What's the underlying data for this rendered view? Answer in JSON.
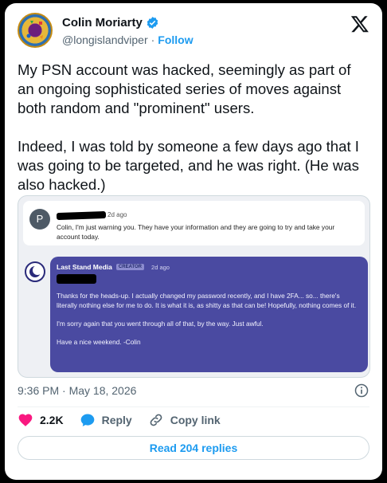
{
  "author": {
    "name": "Colin Moriarty",
    "handle": "@longislandviper",
    "separator": "·",
    "follow_label": "Follow"
  },
  "tweet": {
    "text": "My PSN account was hacked, seemingly as part of an ongoing sophisticated series of moves against both random and \"prominent\" users.\n\nIndeed, I was told by someone a few days ago that I was going to be targeted, and he was right. (He was also hacked.)"
  },
  "media": {
    "message1": {
      "avatar_letter": "P",
      "time": "2d ago",
      "text": "Colin, I'm just warning you. They have your information and they are going to try and take your account today."
    },
    "message2": {
      "author": "Last Stand Media",
      "badge": "CREATOR",
      "time": "2d ago",
      "paragraphs": [
        "Thanks for the heads-up. I actually changed my password recently, and I have 2FA... so... there's literally nothing else for me to do. It is what it is, as shitty as that can be! Hopefully, nothing comes of it.",
        "I'm sorry again that you went through all of that, by the way. Just awful.",
        "Have a nice weekend. -Colin"
      ]
    }
  },
  "meta": {
    "timestamp": "9:36 PM · May 18, 2026"
  },
  "actions": {
    "likes": "2.2K",
    "reply_label": "Reply",
    "copy_link_label": "Copy link"
  },
  "replies_button": "Read 204 replies",
  "colors": {
    "accent": "#1d9bf0",
    "like": "#f91880",
    "bubble": "#4a4aa1"
  },
  "icons": [
    "verified-icon",
    "x-logo-icon",
    "info-icon",
    "heart-icon",
    "reply-bubble-icon",
    "link-icon"
  ]
}
